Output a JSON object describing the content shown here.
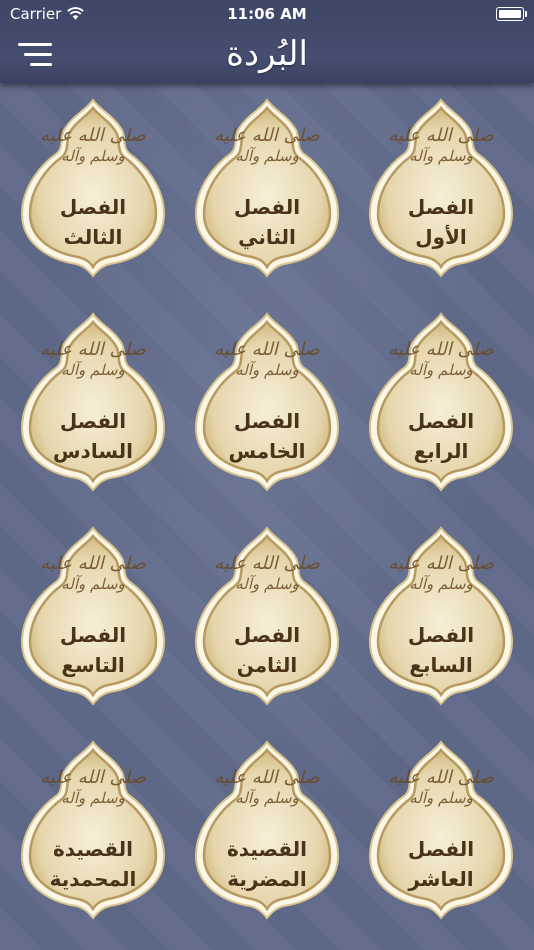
{
  "status_bar": {
    "carrier": "Carrier",
    "time": "11:06 AM"
  },
  "header": {
    "title": "البُردة"
  },
  "salawat_text": {
    "line1": "صلى الله عليه",
    "line2": "وسلم وآله"
  },
  "chapters": [
    {
      "line1": "الفصل",
      "line2": "الأول"
    },
    {
      "line1": "الفصل",
      "line2": "الثاني"
    },
    {
      "line1": "الفصل",
      "line2": "الثالث"
    },
    {
      "line1": "الفصل",
      "line2": "الرابع"
    },
    {
      "line1": "الفصل",
      "line2": "الخامس"
    },
    {
      "line1": "الفصل",
      "line2": "السادس"
    },
    {
      "line1": "الفصل",
      "line2": "السابع"
    },
    {
      "line1": "الفصل",
      "line2": "الثامن"
    },
    {
      "line1": "الفصل",
      "line2": "التاسع"
    },
    {
      "line1": "الفصل",
      "line2": "العاشر"
    },
    {
      "line1": "القصيدة",
      "line2": "المضرية"
    },
    {
      "line1": "القصيدة",
      "line2": "المحمدية"
    }
  ],
  "colors": {
    "background": "#5f6989",
    "header": "#434b6c",
    "tile_fill": "#e9dcb8",
    "tile_border": "#b69a5f",
    "text": "#4a3318"
  }
}
